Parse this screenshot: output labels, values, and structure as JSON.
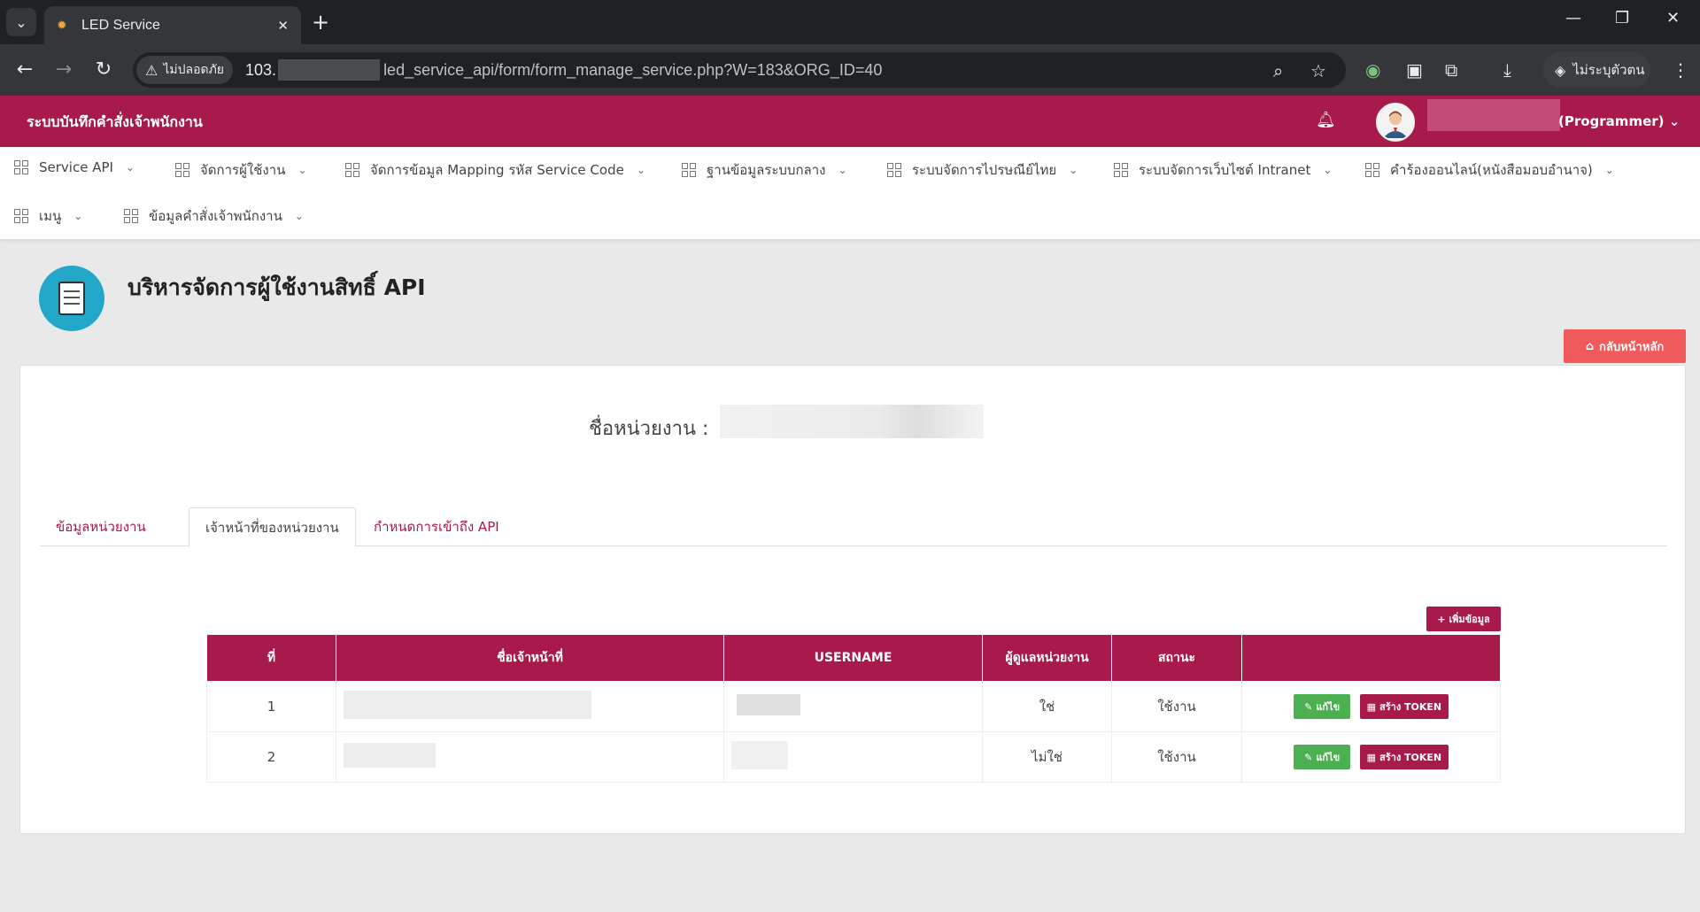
{
  "browser": {
    "tab_title": "LED Service",
    "security_label": "ไม่ปลอดภัย",
    "url_host": "103.",
    "url_path": "led_service_api/form/form_manage_service.php?W=183&ORG_ID=40",
    "profile_label": "ไม่ระบุตัวตน"
  },
  "header": {
    "app_title": "ระบบบันทึกคำสั่งเจ้าพนักงาน",
    "user_name": "(Programmer)"
  },
  "nav": {
    "items": [
      {
        "label": "Service API"
      },
      {
        "label": "จัดการผู้ใช้งาน"
      },
      {
        "label": "จัดการข้อมูล Mapping รหัส Service Code"
      },
      {
        "label": "ฐานข้อมูลระบบกลาง"
      },
      {
        "label": "ระบบจัดการไปรษณีย์ไทย"
      },
      {
        "label": "ระบบจัดการเว็บไซต์ Intranet"
      },
      {
        "label": "คำร้องออนไลน์(หนังสือมอบอำนาจ)"
      },
      {
        "label": "เมนู"
      },
      {
        "label": "ข้อมูลคำสั่งเจ้าพนักงาน"
      }
    ]
  },
  "page": {
    "title": "บริหารจัดการผู้ใช้งานสิทธิ์ API",
    "home_button": "กลับหน้าหลัก",
    "org_label": "ชื่อหน่วยงาน :",
    "tabs": [
      {
        "label": "ข้อมูลหน่วยงาน"
      },
      {
        "label": "เจ้าหน้าที่ของหน่วยงาน"
      },
      {
        "label": "กำหนดการเข้าถึง API"
      }
    ],
    "add_button": "+ เพิ่มข้อมูล"
  },
  "table": {
    "headers": [
      "ที่",
      "ชื่อเจ้าหน้าที่",
      "USERNAME",
      "ผู้ดูแลหน่วยงาน",
      "สถานะ",
      ""
    ],
    "rows": [
      {
        "no": "1",
        "admin": "ใช่",
        "status": "ใช้งาน",
        "edit": "แก้ไข",
        "token": "สร้าง TOKEN"
      },
      {
        "no": "2",
        "admin": "ไม่ใช่",
        "status": "ใช้งาน",
        "edit": "แก้ไข",
        "token": "สร้าง TOKEN"
      }
    ]
  },
  "colors": {
    "brand": "#a81a4b",
    "home_button": "#f05a5a",
    "edit_button": "#4caf50",
    "page_icon": "#23a7c9"
  }
}
